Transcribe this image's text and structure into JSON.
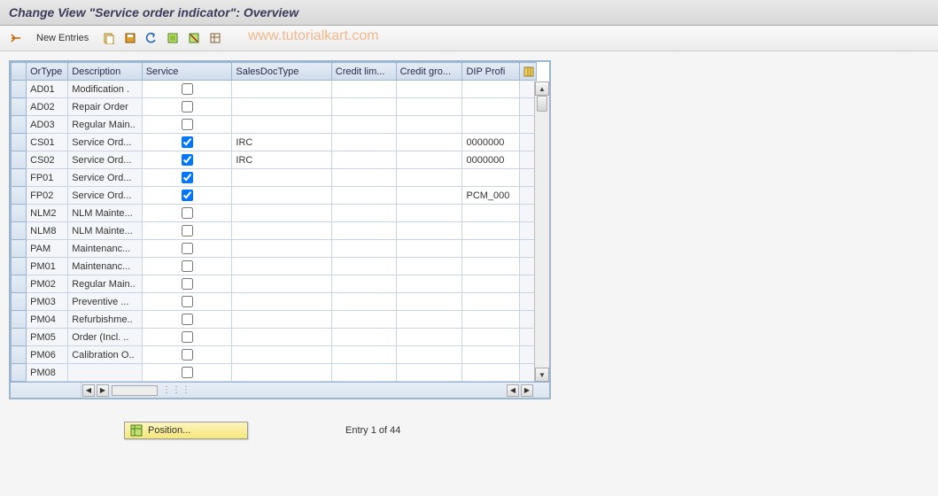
{
  "title": "Change View \"Service order indicator\": Overview",
  "watermark": "www.tutorialkart.com",
  "toolbar": {
    "new_entries": "New Entries"
  },
  "columns": {
    "ortype": "OrType",
    "description": "Description",
    "service": "Service",
    "salesdoc": "SalesDocType",
    "creditlim": "Credit lim...",
    "creditgrp": "Credit gro...",
    "dip": "DIP Profi"
  },
  "rows": [
    {
      "ortype": "AD01",
      "desc": "Modification .",
      "service": false,
      "salesdoc": "",
      "creditlim": "",
      "creditgrp": "",
      "dip": ""
    },
    {
      "ortype": "AD02",
      "desc": "Repair Order",
      "service": false,
      "salesdoc": "",
      "creditlim": "",
      "creditgrp": "",
      "dip": ""
    },
    {
      "ortype": "AD03",
      "desc": "Regular Main..",
      "service": false,
      "salesdoc": "",
      "creditlim": "",
      "creditgrp": "",
      "dip": ""
    },
    {
      "ortype": "CS01",
      "desc": "Service Ord...",
      "service": true,
      "salesdoc": "IRC",
      "creditlim": "",
      "creditgrp": "",
      "dip": "0000000"
    },
    {
      "ortype": "CS02",
      "desc": "Service Ord...",
      "service": true,
      "salesdoc": "IRC",
      "creditlim": "",
      "creditgrp": "",
      "dip": "0000000"
    },
    {
      "ortype": "FP01",
      "desc": "Service Ord...",
      "service": true,
      "salesdoc": "",
      "creditlim": "",
      "creditgrp": "",
      "dip": ""
    },
    {
      "ortype": "FP02",
      "desc": "Service Ord...",
      "service": true,
      "salesdoc": "",
      "creditlim": "",
      "creditgrp": "",
      "dip": "PCM_000"
    },
    {
      "ortype": "NLM2",
      "desc": "NLM Mainte...",
      "service": false,
      "salesdoc": "",
      "creditlim": "",
      "creditgrp": "",
      "dip": ""
    },
    {
      "ortype": "NLM8",
      "desc": "NLM Mainte...",
      "service": false,
      "salesdoc": "",
      "creditlim": "",
      "creditgrp": "",
      "dip": ""
    },
    {
      "ortype": "PAM",
      "desc": "Maintenanc...",
      "service": false,
      "salesdoc": "",
      "creditlim": "",
      "creditgrp": "",
      "dip": ""
    },
    {
      "ortype": "PM01",
      "desc": "Maintenanc...",
      "service": false,
      "salesdoc": "",
      "creditlim": "",
      "creditgrp": "",
      "dip": ""
    },
    {
      "ortype": "PM02",
      "desc": "Regular Main..",
      "service": false,
      "salesdoc": "",
      "creditlim": "",
      "creditgrp": "",
      "dip": ""
    },
    {
      "ortype": "PM03",
      "desc": "Preventive ...",
      "service": false,
      "salesdoc": "",
      "creditlim": "",
      "creditgrp": "",
      "dip": ""
    },
    {
      "ortype": "PM04",
      "desc": "Refurbishme..",
      "service": false,
      "salesdoc": "",
      "creditlim": "",
      "creditgrp": "",
      "dip": ""
    },
    {
      "ortype": "PM05",
      "desc": "Order (Incl. ..",
      "service": false,
      "salesdoc": "",
      "creditlim": "",
      "creditgrp": "",
      "dip": ""
    },
    {
      "ortype": "PM06",
      "desc": "Calibration O..",
      "service": false,
      "salesdoc": "",
      "creditlim": "",
      "creditgrp": "",
      "dip": ""
    },
    {
      "ortype": "PM08",
      "desc": "",
      "service": false,
      "salesdoc": "",
      "creditlim": "",
      "creditgrp": "",
      "dip": ""
    }
  ],
  "footer": {
    "position_label": "Position...",
    "entry_text": "Entry 1 of 44"
  }
}
